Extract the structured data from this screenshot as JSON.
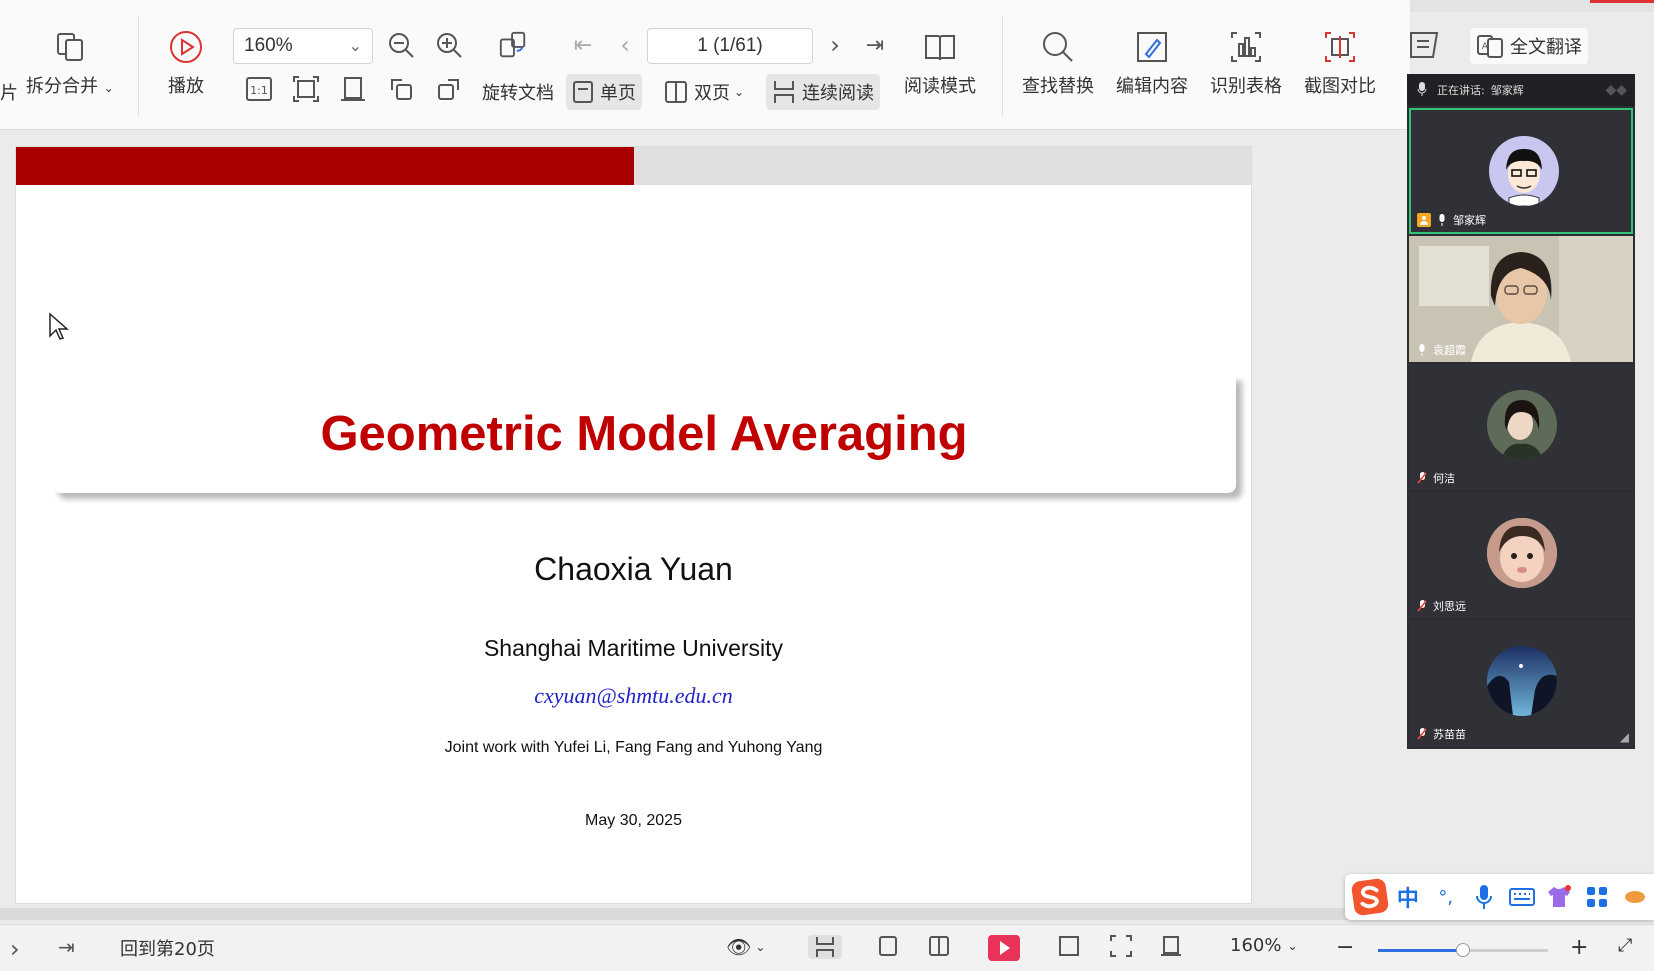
{
  "toolbar": {
    "split_merge": "拆分合并",
    "left_cut": "片",
    "play": "播放",
    "zoom": "160%",
    "rotate": "旋转文档",
    "page": "1 (1/61)",
    "single_page": "单页",
    "double_page": "双页",
    "continuous": "连续阅读",
    "reading_mode": "阅读模式",
    "find_replace": "查找替换",
    "edit_content": "编辑内容",
    "recognize_table": "识别表格",
    "screenshot_compare": "截图对比",
    "full_translate": "全文翻译",
    "ratio_label": "1:1"
  },
  "slide": {
    "progress": 0.5,
    "title": "Geometric Model Averaging",
    "author": "Chaoxia Yuan",
    "affiliation": "Shanghai Maritime University",
    "email": "cxyuan@shmtu.edu.cn",
    "joint_work": "Joint work with Yufei Li, Fang Fang and Yuhong Yang",
    "date": "May 30, 2025"
  },
  "video_panel": {
    "speaking_label": "正在讲话:",
    "speaking_name": "邹家辉",
    "participants": [
      {
        "name": "邹家辉",
        "mic": "on",
        "speaking": true,
        "host": true
      },
      {
        "name": "袁超霞",
        "mic": "on",
        "speaking": false,
        "host": false
      },
      {
        "name": "何洁",
        "mic": "muted",
        "speaking": false,
        "host": false
      },
      {
        "name": "刘思远",
        "mic": "muted",
        "speaking": false,
        "host": false
      },
      {
        "name": "苏苗苗",
        "mic": "muted",
        "speaking": false,
        "host": false
      }
    ]
  },
  "status_bar": {
    "goto_page": "回到第20页",
    "zoom": "160%",
    "zoom_level": 0.5
  },
  "ime": {
    "mode": "中",
    "punct": "°,"
  },
  "colors": {
    "slide_title": "#c00000",
    "progress": "#a80000",
    "email": "#2323c8",
    "speaking_border": "#31c27c"
  }
}
